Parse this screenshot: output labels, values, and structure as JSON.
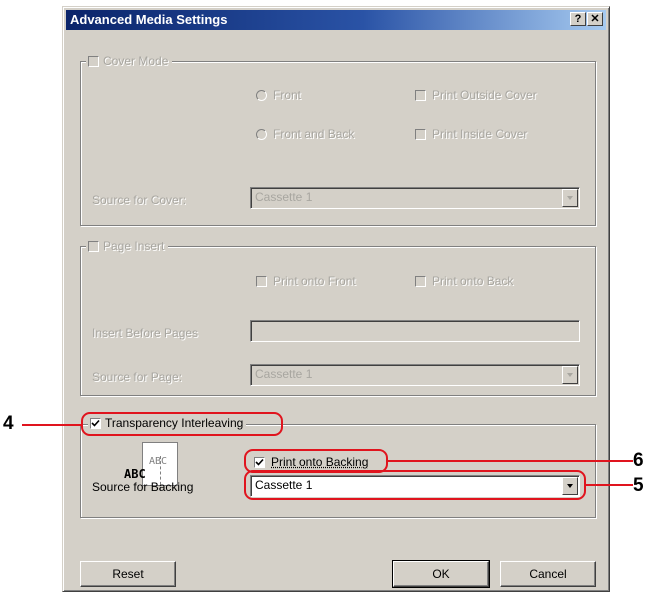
{
  "window": {
    "title": "Advanced Media Settings",
    "help_btn": "?",
    "close_btn": "✕"
  },
  "cover_mode": {
    "label": "Cover Mode",
    "front": "Front",
    "front_and_back": "Front and Back",
    "print_outside_cover": "Print Outside Cover",
    "print_inside_cover": "Print Inside Cover",
    "source_label": "Source for Cover:",
    "source_value": "Cassette 1"
  },
  "page_insert": {
    "label": "Page Insert",
    "print_onto_front": "Print onto Front",
    "print_onto_back": "Print onto Back",
    "insert_before_label": "Insert Before Pages",
    "source_label": "Source for Page:",
    "source_value": "Cassette 1"
  },
  "transparency": {
    "label": "Transparency Interleaving",
    "checked": true,
    "preview_top": "ABC",
    "preview_bottom": "ABC",
    "print_onto_backing": "Print onto Backing",
    "print_onto_backing_checked": true,
    "source_label": "Source for Backing",
    "source_value": "Cassette 1"
  },
  "buttons": {
    "reset": "Reset",
    "ok": "OK",
    "cancel": "Cancel"
  },
  "callouts": {
    "n4": "4",
    "n5": "5",
    "n6": "6",
    "color": "#e0141e"
  }
}
